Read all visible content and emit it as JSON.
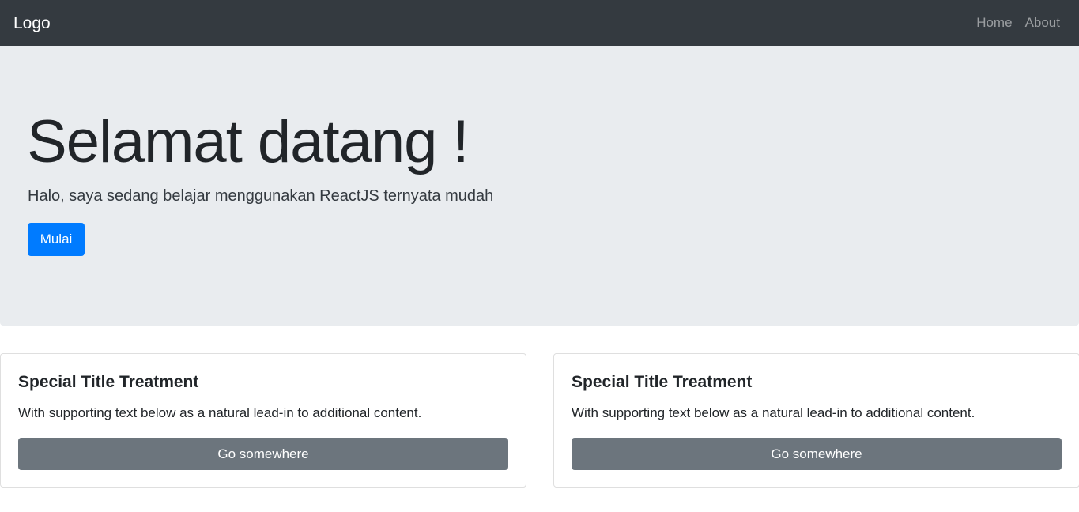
{
  "navbar": {
    "brand": "Logo",
    "links": [
      {
        "label": "Home"
      },
      {
        "label": "About"
      }
    ]
  },
  "hero": {
    "title": "Selamat datang !",
    "lead": "Halo, saya sedang belajar menggunakan ReactJS ternyata mudah",
    "button_label": "Mulai"
  },
  "cards": [
    {
      "title": "Special Title Treatment",
      "text": "With supporting text below as a natural lead-in to additional content.",
      "button_label": "Go somewhere"
    },
    {
      "title": "Special Title Treatment",
      "text": "With supporting text below as a natural lead-in to additional content.",
      "button_label": "Go somewhere"
    }
  ],
  "colors": {
    "navbar_bg": "#343a40",
    "hero_bg": "#e9ecef",
    "primary": "#007bff",
    "secondary": "#6c757d"
  }
}
